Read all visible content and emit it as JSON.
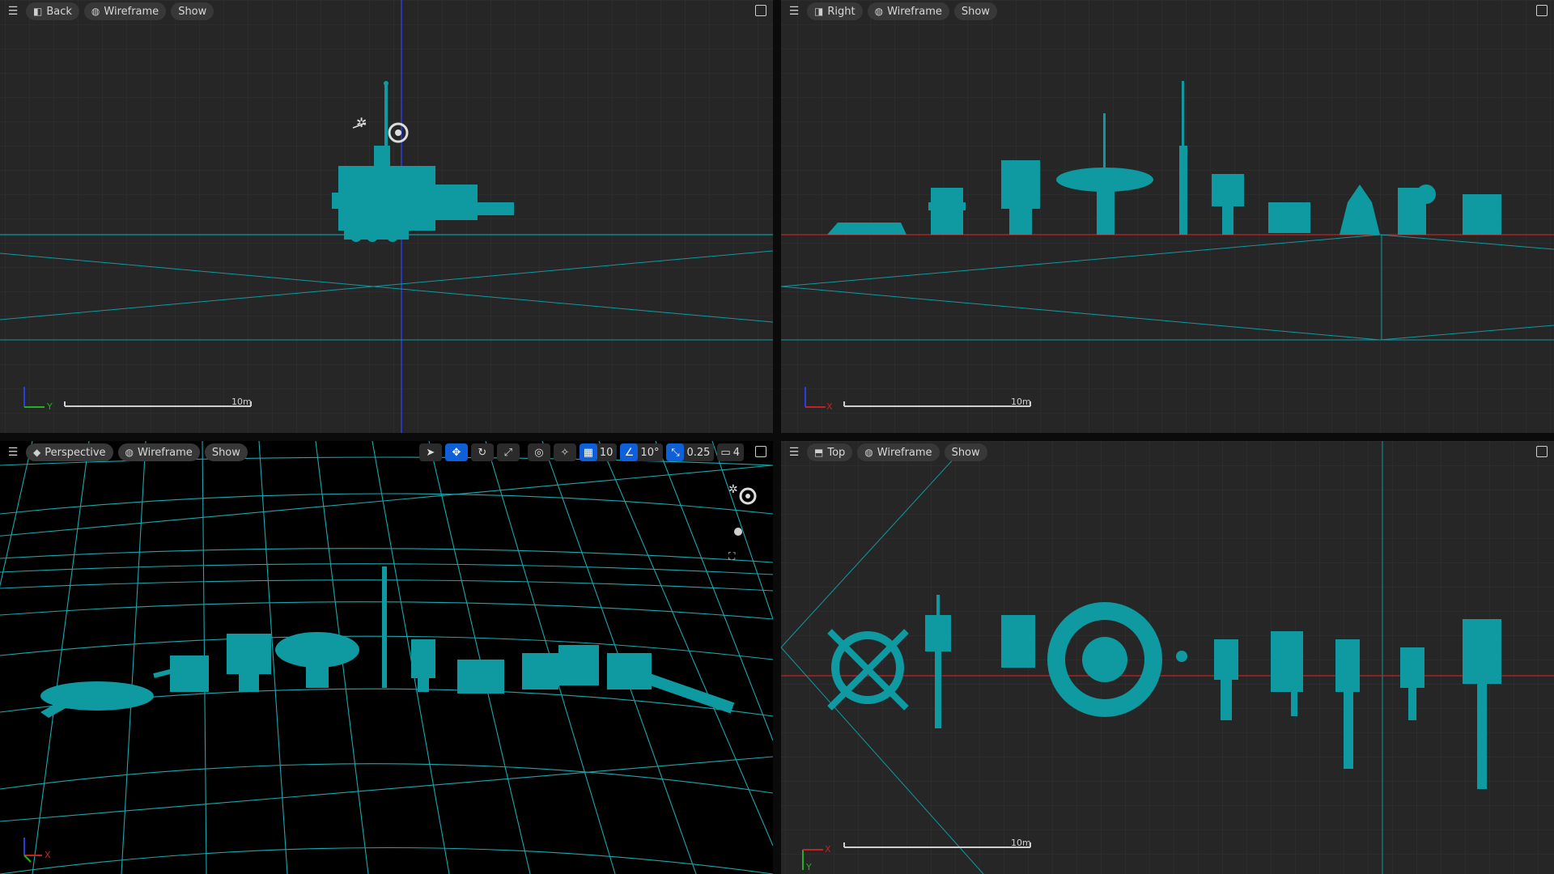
{
  "viewports": {
    "back": {
      "view_label": "Back",
      "mode_label": "Wireframe",
      "show_label": "Show",
      "scale_label": "10m",
      "axis_h": "Y"
    },
    "right": {
      "view_label": "Right",
      "mode_label": "Wireframe",
      "show_label": "Show",
      "scale_label": "10m",
      "axis_h": "X"
    },
    "perspective": {
      "view_label": "Perspective",
      "mode_label": "Wireframe",
      "show_label": "Show",
      "axis_h": "X",
      "toolbar": {
        "grid_snap": "10",
        "rotation_snap": "10°",
        "scale_snap": "0.25",
        "camera_speed": "4"
      }
    },
    "top": {
      "view_label": "Top",
      "mode_label": "Wireframe",
      "show_label": "Show",
      "scale_label": "10m",
      "axis_h": "X",
      "axis_v": "Y"
    }
  },
  "colors": {
    "mesh": "#0e9aa0",
    "grid_line": "#3a3a3a",
    "x_axis": "#c42222",
    "y_axis": "#22b122",
    "z_axis": "#2a3ee0",
    "persp_grid": "#1aa8ad"
  },
  "icons": [
    "menu-icon",
    "wireframe-icon",
    "maximize-icon",
    "select-icon",
    "translate-icon",
    "rotate-icon",
    "scale-icon",
    "world-icon",
    "surface-snap-icon",
    "grid-snap-icon",
    "rotation-snap-icon",
    "scale-snap-icon",
    "camera-speed-icon"
  ]
}
